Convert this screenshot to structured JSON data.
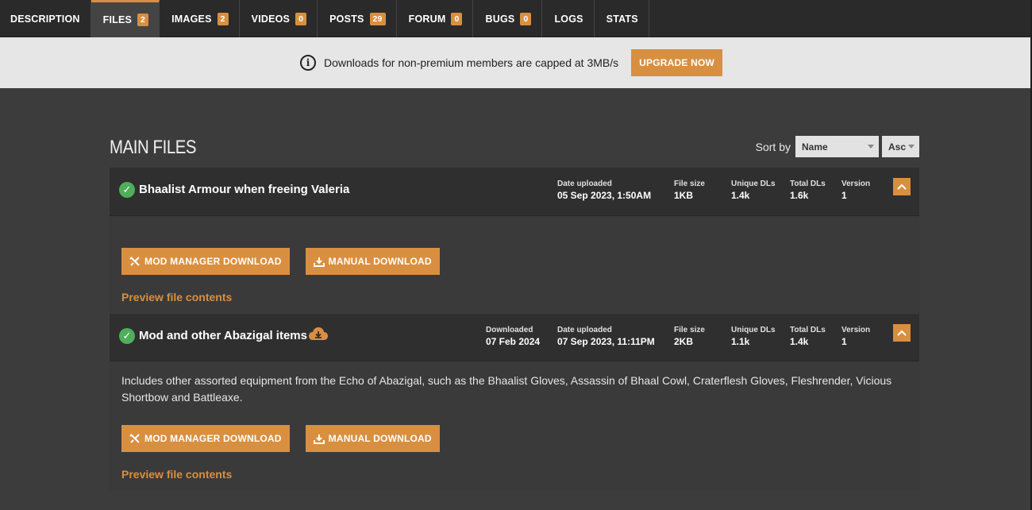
{
  "tabs": [
    {
      "label": "DESCRIPTION",
      "count": null
    },
    {
      "label": "FILES",
      "count": "2",
      "active": true
    },
    {
      "label": "IMAGES",
      "count": "2"
    },
    {
      "label": "VIDEOS",
      "count": "0"
    },
    {
      "label": "POSTS",
      "count": "29"
    },
    {
      "label": "FORUM",
      "count": "0"
    },
    {
      "label": "BUGS",
      "count": "0"
    },
    {
      "label": "LOGS",
      "count": null
    },
    {
      "label": "STATS",
      "count": null
    }
  ],
  "notice": {
    "text": "Downloads for non-premium members are capped at 3MB/s",
    "button": "UPGRADE NOW"
  },
  "section": {
    "title": "MAIN FILES",
    "sort_label": "Sort by",
    "sort_field": "Name",
    "sort_dir": "Asc"
  },
  "labels": {
    "downloaded": "Downloaded",
    "date_uploaded": "Date uploaded",
    "file_size": "File size",
    "unique_dls": "Unique DLs",
    "total_dls": "Total DLs",
    "version": "Version",
    "mod_manager_download": "MOD MANAGER DOWNLOAD",
    "manual_download": "MANUAL DOWNLOAD",
    "preview": "Preview file contents"
  },
  "files": [
    {
      "name": "Bhaalist Armour when freeing Valeria",
      "date_uploaded": "05 Sep 2023, 1:50AM",
      "file_size": "1KB",
      "unique_dls": "1.4k",
      "total_dls": "1.6k",
      "version": "1",
      "description": ""
    },
    {
      "name": "Mod and other Abazigal items",
      "downloaded": "07 Feb 2024",
      "date_uploaded": "07 Sep 2023, 11:11PM",
      "file_size": "2KB",
      "unique_dls": "1.1k",
      "total_dls": "1.4k",
      "version": "1",
      "description": "Includes other assorted equipment from the Echo of Abazigal, such as the Bhaalist Gloves, Assassin of Bhaal Cowl, Craterflesh Gloves, Fleshrender, Vicious Shortbow and Battleaxe."
    }
  ],
  "colors": {
    "accent": "#d98f40",
    "check": "#4fae5b",
    "background": "#3c3c3c"
  }
}
